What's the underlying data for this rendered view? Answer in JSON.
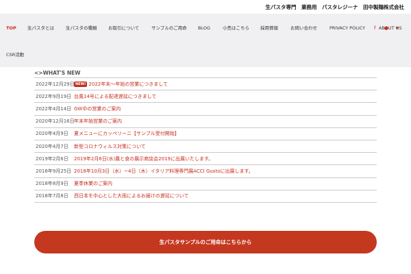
{
  "topbar": {
    "text": "生パスタ専門　業務用　パスタレジーナ　田中製麺株式会社"
  },
  "nav": {
    "items": [
      "TOP",
      "生パスタとは",
      "生パスタの種類",
      "お取引について",
      "サンプルのご用命",
      "BLOG",
      "小売はこちら",
      "採用情報",
      "お問い合わせ",
      "PRIVACY POLICY",
      "ABOUT US"
    ],
    "row2": "CSR活動"
  },
  "social": {
    "icons": [
      "facebook-icon",
      "instagram-icon",
      "twitter-icon"
    ]
  },
  "news": {
    "heading": "<>WHAT'S NEW",
    "badge": "NEW!",
    "items": [
      {
        "date": "2022年12月29日",
        "title": "2022年末～年始の営業につきまして"
      },
      {
        "date": "2022年9月19日",
        "title": "台風14号による配達遅延につきまして"
      },
      {
        "date": "2022年4月14日",
        "title": "GW中の営業のご案内"
      },
      {
        "date": "2020年12月16日",
        "title": "年末年始営業のご案内"
      },
      {
        "date": "2020年4月9日",
        "title": "夏メニューにカッペリーニ【サンプル受付開始】"
      },
      {
        "date": "2020年4月7日",
        "title": "新型コロナウィルス対策について"
      },
      {
        "date": "2019年2月6日",
        "title": "2019年2月6日(水)農と食の展示商談会2019に出展いたします。"
      },
      {
        "date": "2018年9月25日",
        "title": "2018年10月3日（水）~4日（木）イタリア料理専門展ACCI Gustoに出展します。"
      },
      {
        "date": "2018年8月9日",
        "title": "夏季休業のご案内"
      },
      {
        "date": "2018年7月8日",
        "title": "西日本を中心とした大雨によるお届けの遅延について"
      }
    ]
  },
  "cta": {
    "label": "生パスタサンプルのご用命はこちらから"
  },
  "colors": {
    "accent": "#c62d1f",
    "nav_bg": "#f0f0f2",
    "cta_bg": "#c4381f"
  }
}
